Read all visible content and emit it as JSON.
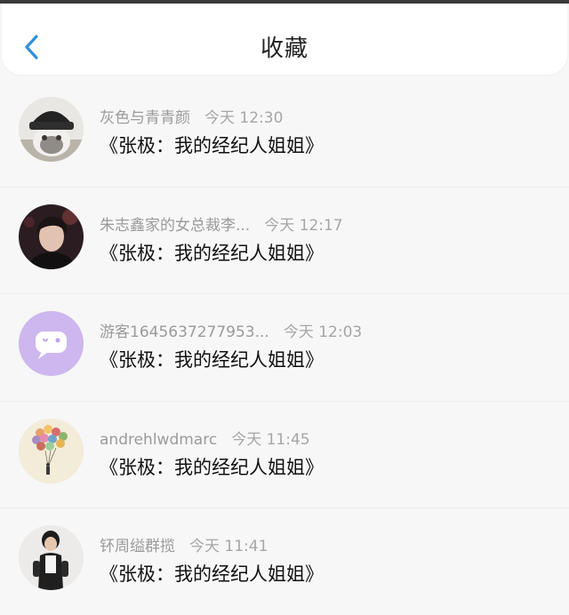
{
  "header": {
    "title": "收藏",
    "back_icon": "chevron-left-icon",
    "accent": "#2f8fd8"
  },
  "items": [
    {
      "user": "灰色与青青颜",
      "time": "今天 12:30",
      "content": "《张极：我的经纪人姐姐》",
      "avatar": "cat-with-beanie-avatar"
    },
    {
      "user": "朱志鑫家的女总裁李...",
      "time": "今天 12:17",
      "content": "《张极：我的经纪人姐姐》",
      "avatar": "portrait-avatar"
    },
    {
      "user": "游客1645637277953...",
      "time": "今天 12:03",
      "content": "《张极：我的经纪人姐姐》",
      "avatar": "chat-bubble-avatar"
    },
    {
      "user": "andrehlwdmarc",
      "time": "今天 11:45",
      "content": "《张极：我的经纪人姐姐》",
      "avatar": "balloons-avatar"
    },
    {
      "user": "钚周缢群揽",
      "time": "今天 11:41",
      "content": "《张极：我的经纪人姐姐》",
      "avatar": "child-avatar"
    }
  ]
}
